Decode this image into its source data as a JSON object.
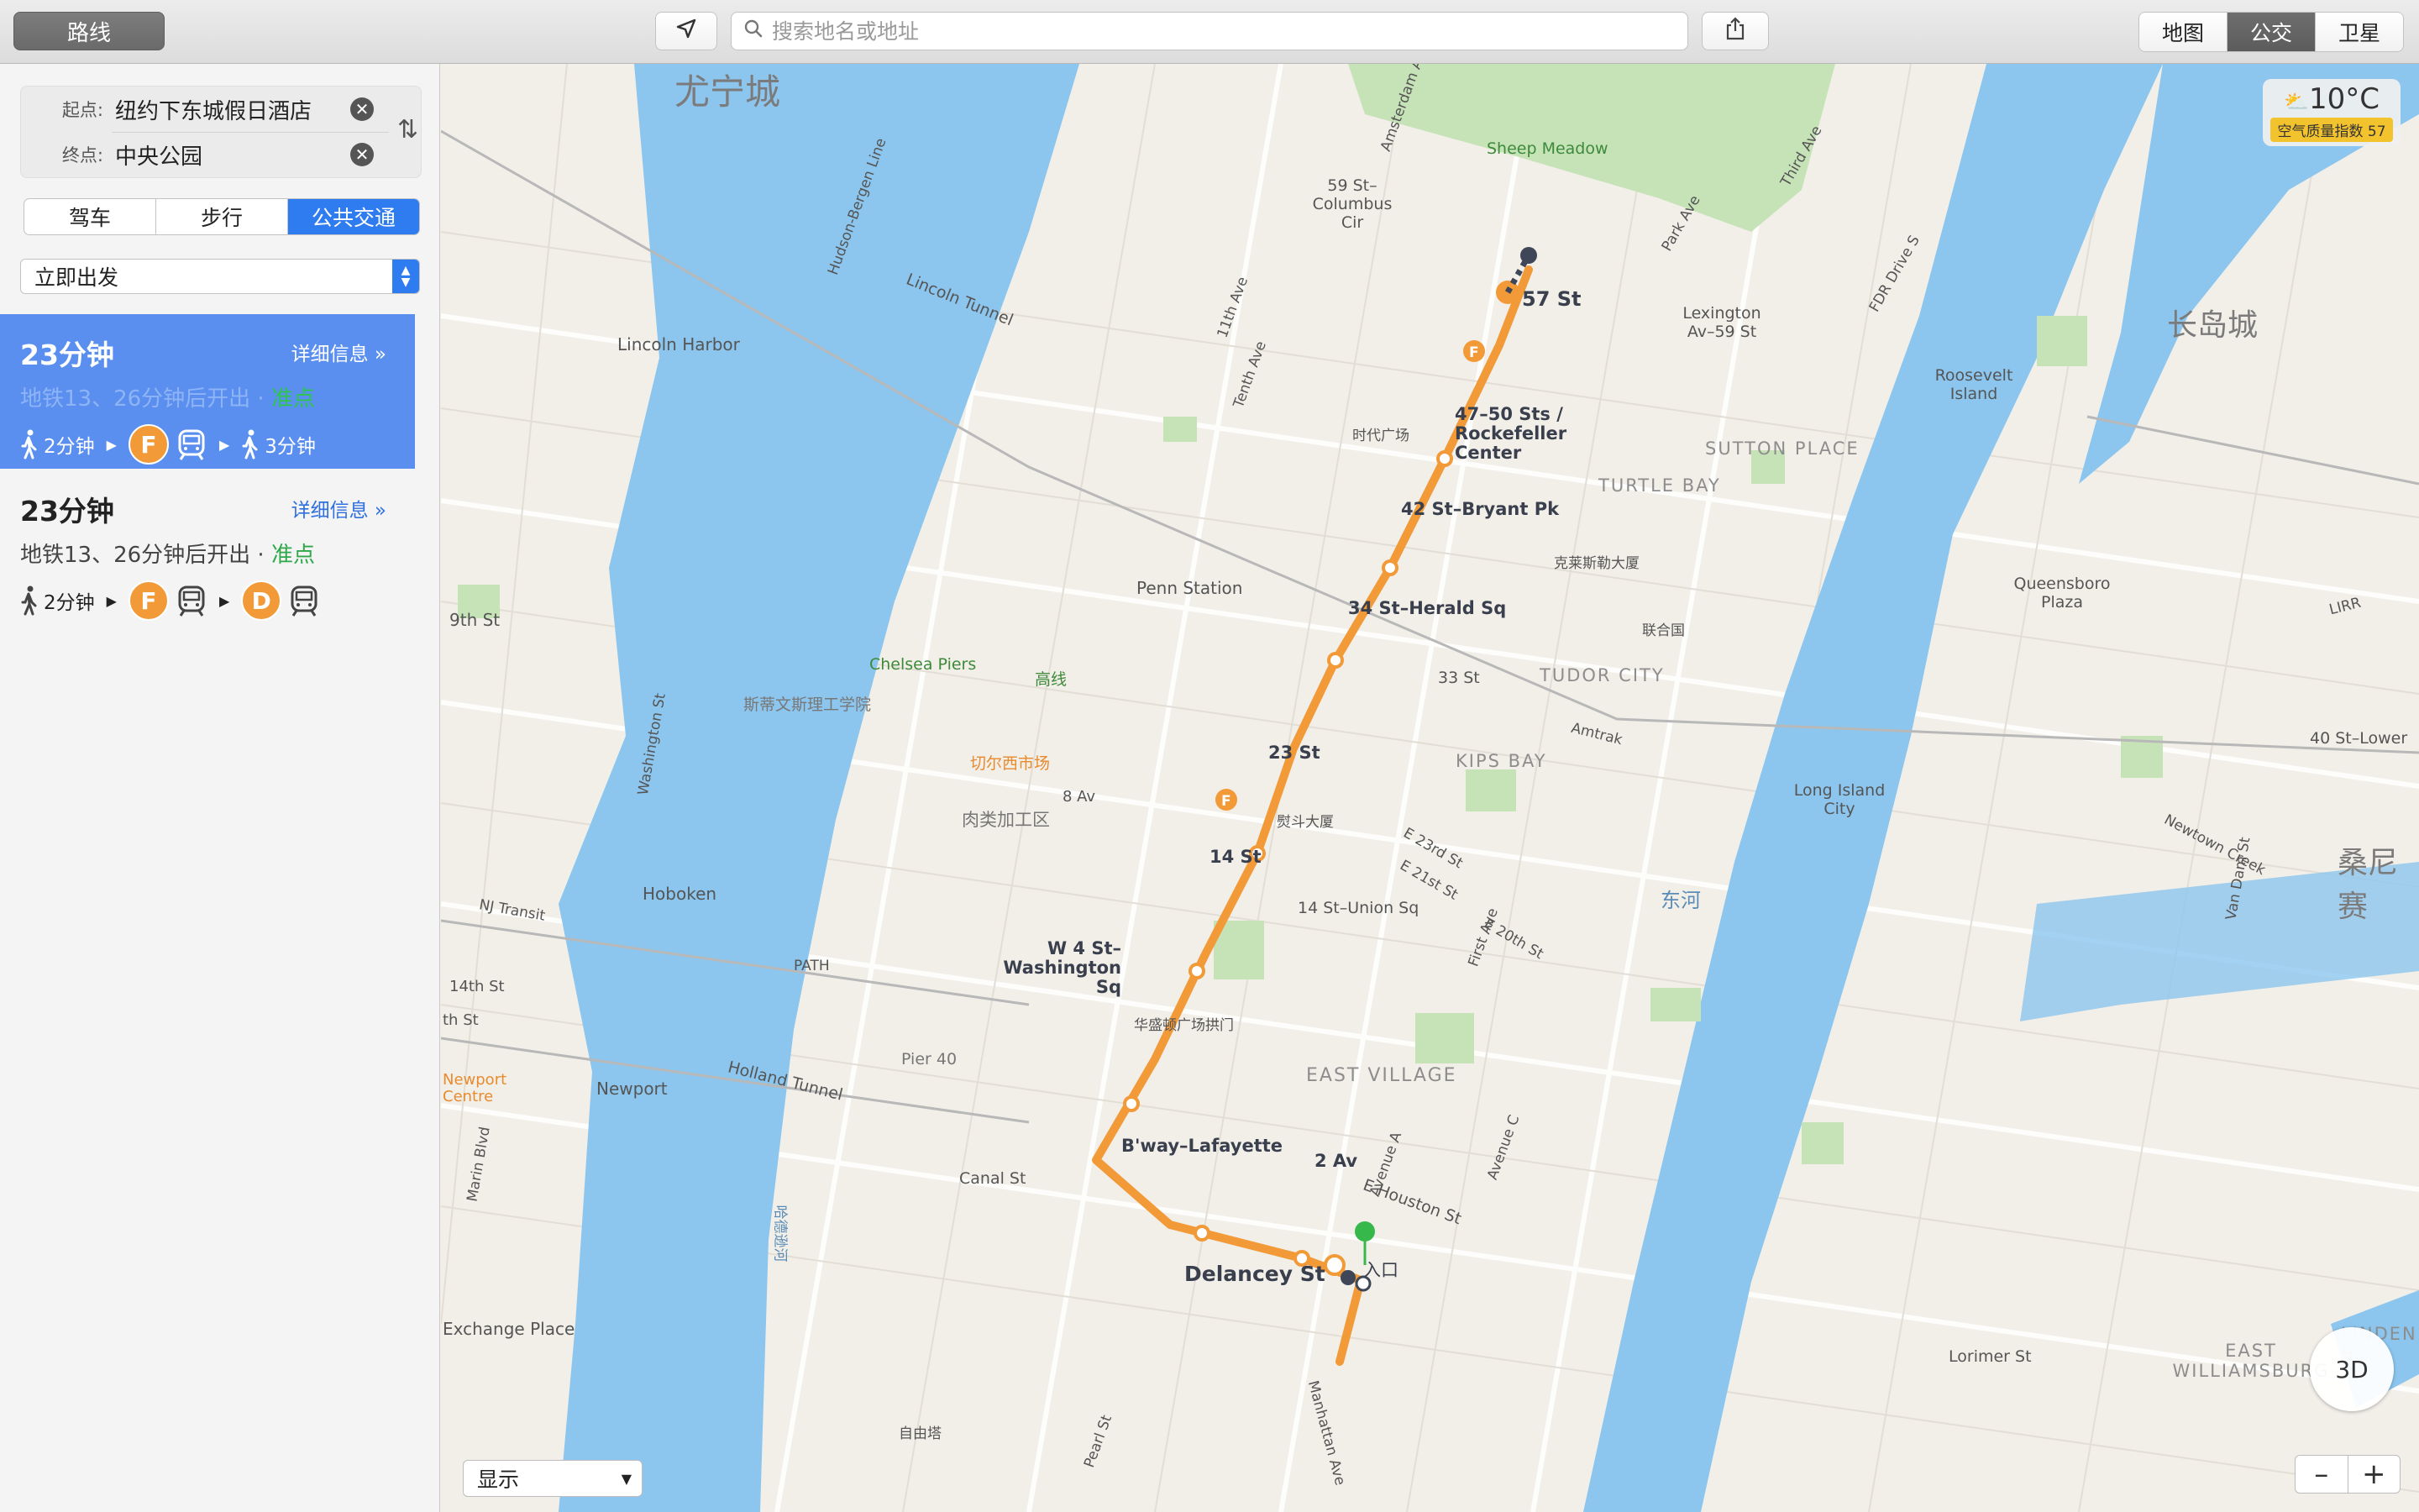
{
  "toolbar": {
    "routes_label": "路线",
    "search_placeholder": "搜索地名或地址",
    "map_modes": [
      "地图",
      "公交",
      "卫星"
    ],
    "active_map_mode": "公交"
  },
  "sidebar": {
    "origin_label": "起点:",
    "origin_value": "纽约下东城假日酒店",
    "destination_label": "终点:",
    "destination_value": "中央公园",
    "modes": [
      "驾车",
      "步行",
      "公共交通"
    ],
    "active_mode": "公共交通",
    "depart_option": "立即出发",
    "routes": [
      {
        "time": "23分钟",
        "detail": "详细信息",
        "sub": "地铁13、26分钟后开出",
        "status": "准点",
        "walk1": "2分钟",
        "line1": "F",
        "walk2": "3分钟"
      },
      {
        "time": "23分钟",
        "detail": "详细信息",
        "sub": "地铁13、26分钟后开出",
        "status": "准点",
        "walk1": "2分钟",
        "line1": "F",
        "line2": "D"
      }
    ]
  },
  "colors": {
    "line_f": "#f29a38",
    "line_d": "#f29a38",
    "accent": "#2f7bf0",
    "water": "#8cc6ee",
    "park": "#c6e3b8"
  },
  "map": {
    "weather_temp": "10°C",
    "aqi": "空气质量指数 57",
    "compass": "3D",
    "show_select": "显示",
    "zoom_out": "–",
    "zoom_in": "+",
    "stations": [
      "57 St",
      "47–50 Sts / Rockefeller Center",
      "42 St–Bryant Pk",
      "34 St–Herald Sq",
      "23 St",
      "14 St",
      "W 4 St–Washington Sq",
      "B'way–Lafayette",
      "2 Av",
      "Delancey St"
    ],
    "entrance_label": "入口",
    "area_labels": [
      "尤宁城",
      "长岛城",
      "桑尼赛",
      "Sheep Meadow",
      "59 St–Columbus Cir",
      "Lexington Av–59 St",
      "Lincoln Harbor",
      "时代广场",
      "SUTTON PLACE",
      "TURTLE BAY",
      "Roosevelt Island",
      "克莱斯勒大厦",
      "Queensboro Plaza",
      "Penn Station",
      "联合国",
      "9th St",
      "Chelsea Piers",
      "高线",
      "33 St",
      "TUDOR CITY",
      "斯蒂文斯理工学院",
      "切尔西市场",
      "KIPS BAY",
      "40 St–Lower",
      "熨斗大厦",
      "肉类加工区",
      "8 Av",
      "Long Island City",
      "Hoboken",
      "14 St–Union Sq",
      "东河",
      "华盛顿广场拱门",
      "Pier 40",
      "EAST VILLAGE",
      "Newport",
      "Newport Centre",
      "Canal St",
      "E Houston St",
      "Exchange Place",
      "LINDEN H",
      "EAST WILLIAMSBURG",
      "Lorimer St",
      "自由塔",
      "Holland Tunnel",
      "Lincoln Tunnel",
      "PATH",
      "NJ Transit",
      "Amtrak",
      "Newtown Creek",
      "Park Ave",
      "Washington St",
      "Marin Blvd",
      "11th Ave",
      "Tenth Ave",
      "Amsterdam Ave",
      "Third Ave",
      "FDR Drive S",
      "Avenue A",
      "Avenue C",
      "First Ave",
      "E 23rd St",
      "E 21st St",
      "E 20th St",
      "Van Dam St",
      "Manhattan Ave",
      "Pearl St",
      "Hudson-Bergen Line",
      "14th St",
      "th St",
      "LIRR",
      "哈德逊河"
    ]
  }
}
